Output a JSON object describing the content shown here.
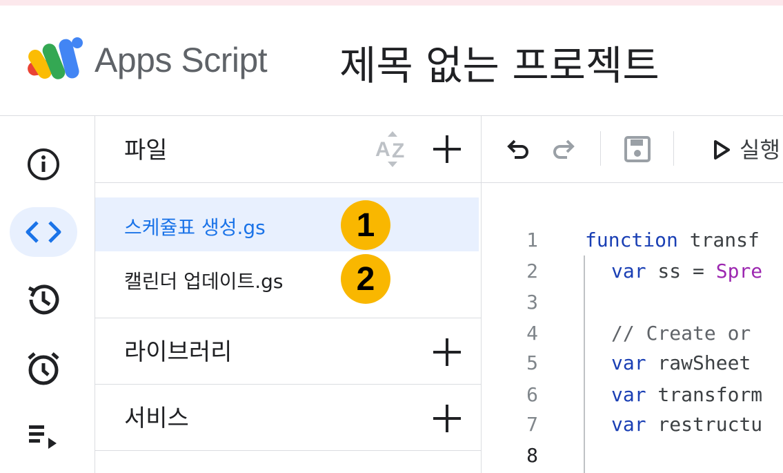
{
  "header": {
    "app_name": "Apps Script",
    "project_title": "제목 없는 프로젝트"
  },
  "rail": {
    "items": [
      {
        "icon": "info-icon"
      },
      {
        "icon": "code-icon",
        "active": true
      },
      {
        "icon": "history-icon"
      },
      {
        "icon": "alarm-clock-icon"
      },
      {
        "icon": "executions-icon"
      }
    ]
  },
  "files_panel": {
    "files_title": "파일",
    "sort_icon": "sort-az-icon",
    "files": [
      {
        "name": "스케쥴표 생성.gs",
        "badge": "1",
        "selected": true
      },
      {
        "name": "캘린더 업데이트.gs",
        "badge": "2",
        "selected": false
      }
    ],
    "libraries_title": "라이브러리",
    "services_title": "서비스"
  },
  "toolbar": {
    "undo_icon": "undo-icon",
    "redo_icon": "redo-icon",
    "save_icon": "save-icon",
    "run_label": "실행"
  },
  "code": {
    "lines": [
      {
        "num": "1",
        "text": "function transf"
      },
      {
        "num": "2",
        "text": "  var ss = Spre"
      },
      {
        "num": "3",
        "text": ""
      },
      {
        "num": "4",
        "text": "  // Create or "
      },
      {
        "num": "5",
        "text": "  var rawSheet "
      },
      {
        "num": "6",
        "text": "  var transform"
      },
      {
        "num": "7",
        "text": "  var restructu"
      },
      {
        "num": "8",
        "text": ""
      }
    ],
    "l1_kw": "function",
    "l1_rest": " transf",
    "l2_kw": "var",
    "l2_mid": " ss = ",
    "l2_fn": "Spre",
    "l4_cm": "// Create or",
    "l5_kw": "var",
    "l5_rest": " rawSheet",
    "l6_kw": "var",
    "l6_rest": " transform",
    "l7_kw": "var",
    "l7_rest": " restructu"
  },
  "colors": {
    "accent": "#1a73e8",
    "selected_bg": "#e8f0fe",
    "badge": "#f9b700"
  }
}
